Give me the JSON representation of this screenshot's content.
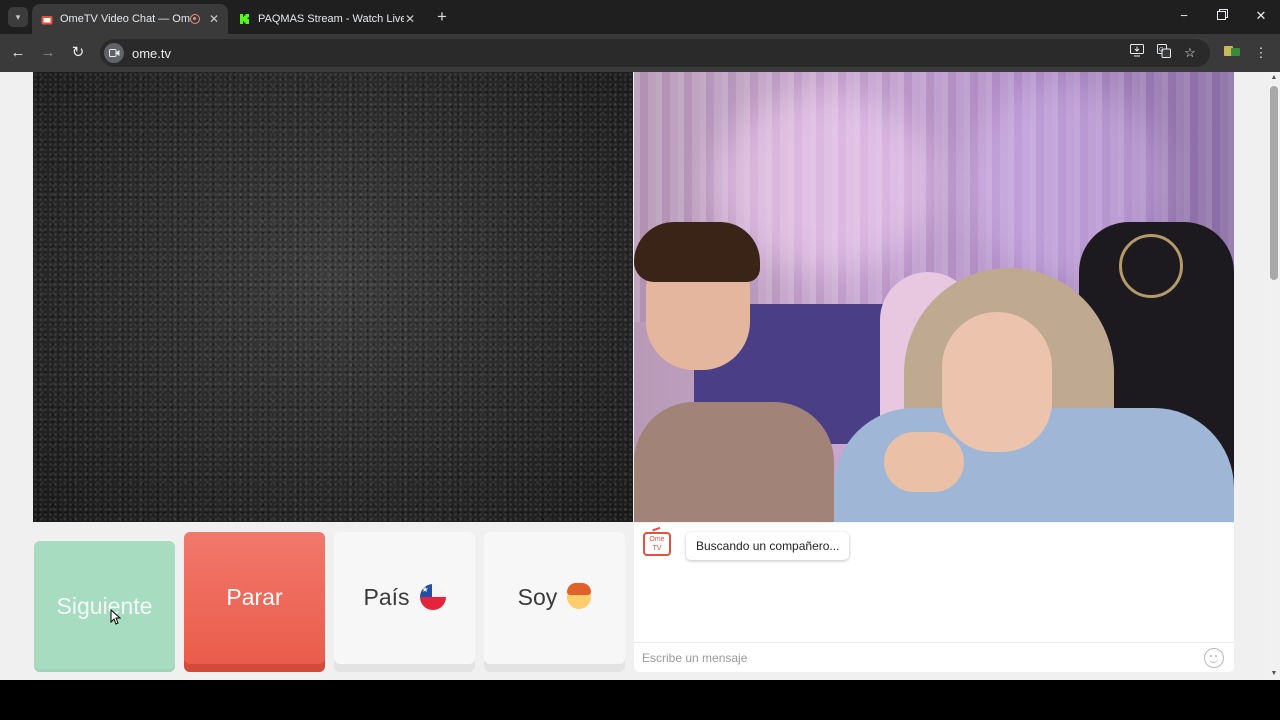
{
  "browser": {
    "tabs": [
      {
        "title": "OmeTV Video Chat — Ome",
        "active": true,
        "favicon": "ometv-icon",
        "recording": true
      },
      {
        "title": "PAQMAS Stream - Watch Live o",
        "active": false,
        "favicon": "kick-icon"
      }
    ],
    "url": "ome.tv"
  },
  "controls": {
    "next_label": "Siguiente",
    "stop_label": "Parar",
    "country_label": "País",
    "gender_label": "Soy",
    "country_flag": "chile-flag-icon",
    "gender_icon": "boy-emoji-icon"
  },
  "chat": {
    "logo_text": "Ome TV",
    "status_message": "Buscando un compañero...",
    "input_placeholder": "Escribe un mensaje"
  },
  "colors": {
    "next_button": "#a8dcc0",
    "stop_button": "#ea5a49",
    "accent": "#e2523f"
  }
}
